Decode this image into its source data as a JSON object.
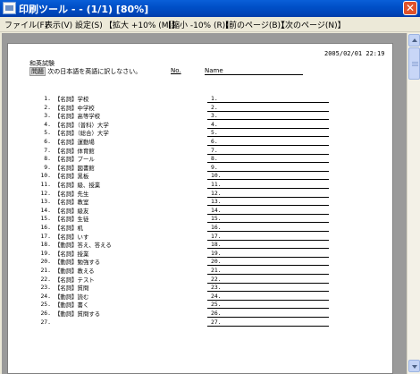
{
  "window": {
    "title": "印刷ツール - - (1/1) [80%]",
    "close_glyph": "✕"
  },
  "menu": [
    {
      "label": "ファイル(F)",
      "name": "menu-file"
    },
    {
      "label": "表示(V)",
      "name": "menu-view"
    },
    {
      "label": "設定(S)",
      "name": "menu-settings"
    },
    {
      "label": "【拡大 +10% (M)】",
      "name": "menu-zoom-in"
    },
    {
      "label": "【縮小 -10% (R)】",
      "name": "menu-zoom-out"
    },
    {
      "label": "【前のページ(B)】",
      "name": "menu-prev-page"
    },
    {
      "label": "【次のページ(N)】",
      "name": "menu-next-page"
    }
  ],
  "paper": {
    "date": "2005/02/01 22:19",
    "test_title": "和英試験",
    "mondai_badge": "問題",
    "mondai_text": "次の日本語を英語に訳しなさい。",
    "no_label": "No.",
    "name_label": "Name"
  },
  "questions": [
    {
      "num": "1.",
      "text": "【名詞】学校",
      "ans": "1."
    },
    {
      "num": "2.",
      "text": "【名詞】中学校",
      "ans": "2."
    },
    {
      "num": "3.",
      "text": "【名詞】高等学校",
      "ans": "3."
    },
    {
      "num": "4.",
      "text": "【名詞】（普科）大学",
      "ans": "4."
    },
    {
      "num": "5.",
      "text": "【名詞】（総合）大学",
      "ans": "5."
    },
    {
      "num": "6.",
      "text": "【名詞】運動場",
      "ans": "6."
    },
    {
      "num": "7.",
      "text": "【名詞】体育館",
      "ans": "7."
    },
    {
      "num": "8.",
      "text": "【名詞】プール",
      "ans": "8."
    },
    {
      "num": "9.",
      "text": "【名詞】図書館",
      "ans": "9."
    },
    {
      "num": "10.",
      "text": "【名詞】黒板",
      "ans": "10."
    },
    {
      "num": "11.",
      "text": "【名詞】級、授業",
      "ans": "11."
    },
    {
      "num": "12.",
      "text": "【名詞】先生",
      "ans": "12."
    },
    {
      "num": "13.",
      "text": "【名詞】教室",
      "ans": "13."
    },
    {
      "num": "14.",
      "text": "【名詞】級友",
      "ans": "14."
    },
    {
      "num": "15.",
      "text": "【名詞】生徒",
      "ans": "15."
    },
    {
      "num": "16.",
      "text": "【名詞】机",
      "ans": "16."
    },
    {
      "num": "17.",
      "text": "【名詞】いす",
      "ans": "17."
    },
    {
      "num": "18.",
      "text": "【動詞】答え、答える",
      "ans": "18."
    },
    {
      "num": "19.",
      "text": "【名詞】授業",
      "ans": "19."
    },
    {
      "num": "20.",
      "text": "【動詞】勉強する",
      "ans": "20."
    },
    {
      "num": "21.",
      "text": "【動詞】教える",
      "ans": "21."
    },
    {
      "num": "22.",
      "text": "【名詞】テスト",
      "ans": "22."
    },
    {
      "num": "23.",
      "text": "【名詞】質問",
      "ans": "23."
    },
    {
      "num": "24.",
      "text": "【動詞】読む",
      "ans": "24."
    },
    {
      "num": "25.",
      "text": "【動詞】書く",
      "ans": "25."
    },
    {
      "num": "26.",
      "text": "【動詞】質問する",
      "ans": "26."
    },
    {
      "num": "27.",
      "text": "",
      "ans": "27."
    }
  ]
}
